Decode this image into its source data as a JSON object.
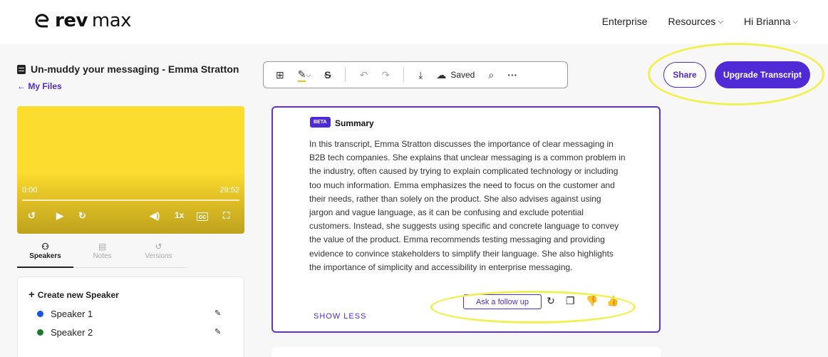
{
  "brand": {
    "word1": "rev",
    "word2": "max"
  },
  "nav": {
    "enterprise": "Enterprise",
    "resources": "Resources",
    "greeting": "Hi Brianna"
  },
  "file": {
    "title": "Un-muddy your messaging - Emma Stratton",
    "back_link": "← My Files"
  },
  "player": {
    "current_time": "0:00",
    "duration": "29:52",
    "speed": "1x"
  },
  "tabs": [
    {
      "label": "Speakers",
      "icon": "speakers-icon",
      "active": true
    },
    {
      "label": "Notes",
      "icon": "notes-icon",
      "active": false
    },
    {
      "label": "Versions",
      "icon": "versions-icon",
      "active": false
    }
  ],
  "speakers_panel": {
    "create_label": "Create new Speaker",
    "speakers": [
      {
        "name": "Speaker 1",
        "color": "#1a56db"
      },
      {
        "name": "Speaker 2",
        "color": "#1f7a2e"
      }
    ]
  },
  "toolbar": {
    "saved_label": "Saved"
  },
  "actions": {
    "share": "Share",
    "upgrade": "Upgrade Transcript"
  },
  "summary": {
    "badge": "BETA",
    "title": "Summary",
    "body": "In this transcript, Emma Stratton discusses the importance of clear messaging in B2B tech companies. She explains that unclear messaging is a common problem in the industry, often caused by trying to explain complicated technology or including too much information. Emma emphasizes the need to focus on the customer and their needs, rather than solely on the product. She also advises against using jargon and vague language, as it can be confusing and exclude potential customers. Instead, she suggests using specific and concrete language to convey the value of the product. Emma recommends testing messaging and providing evidence to convince stakeholders to simplify their language. She also highlights the importance of simplicity and accessibility in enterprise messaging.",
    "follow_up": "Ask a follow up",
    "show_less": "SHOW LESS"
  },
  "colors": {
    "accent": "#4f2bd6",
    "highlight": "#f1f052",
    "video": "#fcdc2e"
  }
}
